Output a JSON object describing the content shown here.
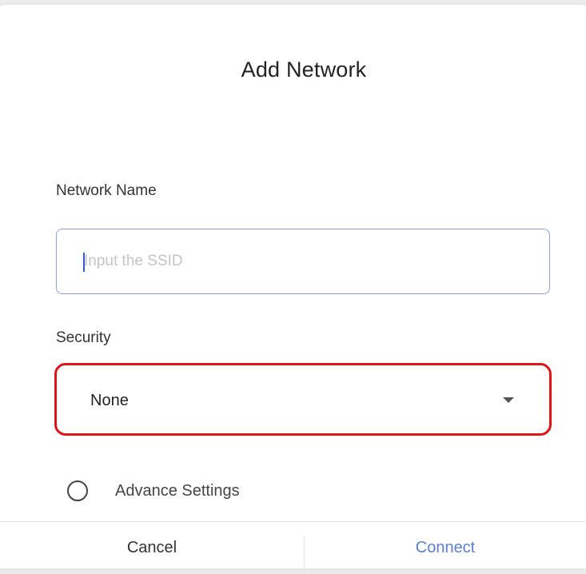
{
  "dialog": {
    "title": "Add Network"
  },
  "network_name": {
    "label": "Network Name",
    "value": "",
    "placeholder": "Input the SSID"
  },
  "security": {
    "label": "Security",
    "selected": "None",
    "highlight_color": "#e01414"
  },
  "advance_settings": {
    "label": "Advance Settings",
    "checked": false
  },
  "footer": {
    "cancel_label": "Cancel",
    "connect_label": "Connect"
  },
  "colors": {
    "accent": "#5b7fd8",
    "input_border": "#8e9be6"
  }
}
